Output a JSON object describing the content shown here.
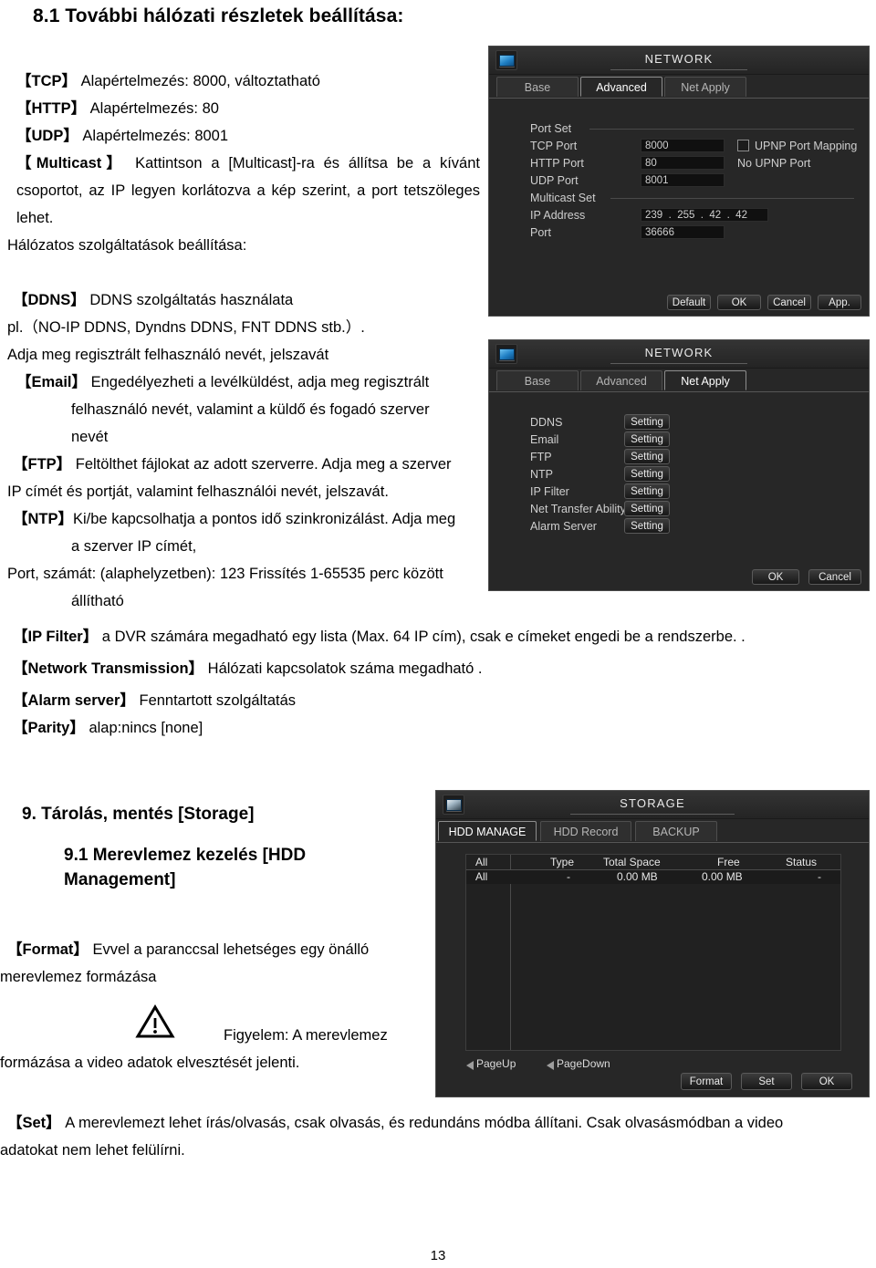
{
  "document": {
    "heading_8_1": "8.1 További hálózati részletek beállítása:",
    "lines": [
      {
        "bold": "【TCP】",
        "rest": " Alapértelmezés: 8000, változtatható"
      },
      {
        "bold": "【HTTP】",
        "rest": " Alapértelmezés: 80"
      },
      {
        "bold": "【UDP】",
        "rest": " Alapértelmezés: 8001"
      }
    ],
    "multicast_bold": "【Multicast】",
    "multicast_rest": "Kattintson a [Multicast]-ra és állítsa be a kívánt csoportot, az IP legyen korlátozva a kép szerint, a port tetszöleges lehet.",
    "services_line": "Hálózatos szolgáltatások beállítása:",
    "ddns_bold": "【DDNS】",
    "ddns_rest": " DDNS szolgáltatás használata",
    "ddns_examples": "pl.（NO-IP DDNS, Dyndns DDNS, FNT DDNS stb.）.",
    "ddns_register": "Adja meg regisztrált felhasználó nevét, jelszavát",
    "email_bold": "【Email】",
    "email_rest": " Engedélyezheti a levélküldést, adja meg regisztrált",
    "email_line2": "felhasználó nevét, valamint a küldő és fogadó szerver",
    "email_line3": "nevét",
    "ftp_bold": "【FTP】",
    "ftp_rest": " Feltölthet fájlokat az adott szerverre. Adja meg a szerver",
    "ftp_line2": "IP címét és portját, valamint felhasználói nevét, jelszavát.",
    "ntp_bold": "【NTP】",
    "ntp_rest": "Ki/be kapcsolhatja a pontos idő szinkronizálást. Adja meg",
    "ntp_line2": "a szerver IP címét,",
    "ntp_line3": "Port, számát: (alaphelyzetben): 123 Frissítés 1-65535 perc között",
    "ntp_line4": "állítható",
    "ipfilter_bold": "【IP Filter】",
    "ipfilter_rest": " a DVR számára megadható egy lista (Max. 64 IP cím), csak e címeket engedi be a rendszerbe. .",
    "nettrans_bold": "【Network Transmission】",
    "nettrans_rest": " Hálózati kapcsolatok száma megadható .",
    "alarmsrv_bold": "【Alarm server】",
    "alarmsrv_rest": " Fenntartott szolgáltatás",
    "parity_bold": "【Parity】",
    "parity_rest": " alap:nincs [none]",
    "heading_9": "9.   Tárolás, mentés [Storage]",
    "heading_9_1_l1": "9.1 Merevlemez kezelés [HDD",
    "heading_9_1_l2": "Management]",
    "format_bold": "【Format】",
    "format_rest": "Evvel a paranccsal lehetséges egy önálló",
    "format_line2": "merevlemez formázása",
    "warning_text": "Figyelem:  A  merevlemez",
    "warning_line2": "formázása a video adatok elvesztését jelenti.",
    "set_bold": "【Set】",
    "set_rest": "A merevlemezt lehet írás/olvasás, csak olvasás, és redundáns   módba állítani. Csak olvasásmódban a video",
    "set_line2": "adatokat nem lehet felülírni.",
    "page_number": "13"
  },
  "network_advanced": {
    "window_title": "NETWORK",
    "icon": "monitor-network-icon",
    "tabs": [
      {
        "label": "Base",
        "active": false
      },
      {
        "label": "Advanced",
        "active": true
      },
      {
        "label": "Net Apply",
        "active": false
      }
    ],
    "group_port_set": "Port Set",
    "group_multicast_set": "Multicast Set",
    "fields": {
      "tcp_label": "TCP Port",
      "tcp_value": "8000",
      "http_label": "HTTP Port",
      "http_value": "80",
      "udp_label": "UDP Port",
      "udp_value": "8001",
      "ip_label": "IP Address",
      "ip_o1": "239",
      "ip_o2": "255",
      "ip_o3": "42",
      "ip_o4": "42",
      "port_label": "Port",
      "port_value": "36666"
    },
    "upnp_checkbox_label": "UPNP Port Mapping",
    "upnp_status": "No UPNP Port",
    "buttons": {
      "default": "Default",
      "ok": "OK",
      "cancel": "Cancel",
      "app": "App."
    }
  },
  "network_netapply": {
    "window_title": "NETWORK",
    "icon": "monitor-network-icon",
    "tabs": [
      {
        "label": "Base",
        "active": false
      },
      {
        "label": "Advanced",
        "active": false
      },
      {
        "label": "Net Apply",
        "active": true
      }
    ],
    "rows": [
      {
        "label": "DDNS",
        "button": "Setting"
      },
      {
        "label": "Email",
        "button": "Setting"
      },
      {
        "label": "FTP",
        "button": "Setting"
      },
      {
        "label": "NTP",
        "button": "Setting"
      },
      {
        "label": "IP Filter",
        "button": "Setting"
      },
      {
        "label": "Net Transfer Ability",
        "button": "Setting"
      },
      {
        "label": "Alarm Server",
        "button": "Setting"
      }
    ],
    "buttons": {
      "ok": "OK",
      "cancel": "Cancel"
    }
  },
  "storage": {
    "window_title": "STORAGE",
    "icon": "hdd-icon",
    "tabs": [
      {
        "label": "HDD MANAGE",
        "active": true
      },
      {
        "label": "HDD Record",
        "active": false
      },
      {
        "label": "BACKUP",
        "active": false
      }
    ],
    "table": {
      "headers": [
        "All",
        "Type",
        "Total Space",
        "Free",
        "Status"
      ],
      "rows": [
        {
          "all": "All",
          "type": "-",
          "total": "0.00 MB",
          "free": "0.00 MB",
          "status": "-"
        }
      ]
    },
    "pageup": "PageUp",
    "pagedown": "PageDown",
    "buttons": {
      "format": "Format",
      "set": "Set",
      "ok": "OK"
    }
  }
}
